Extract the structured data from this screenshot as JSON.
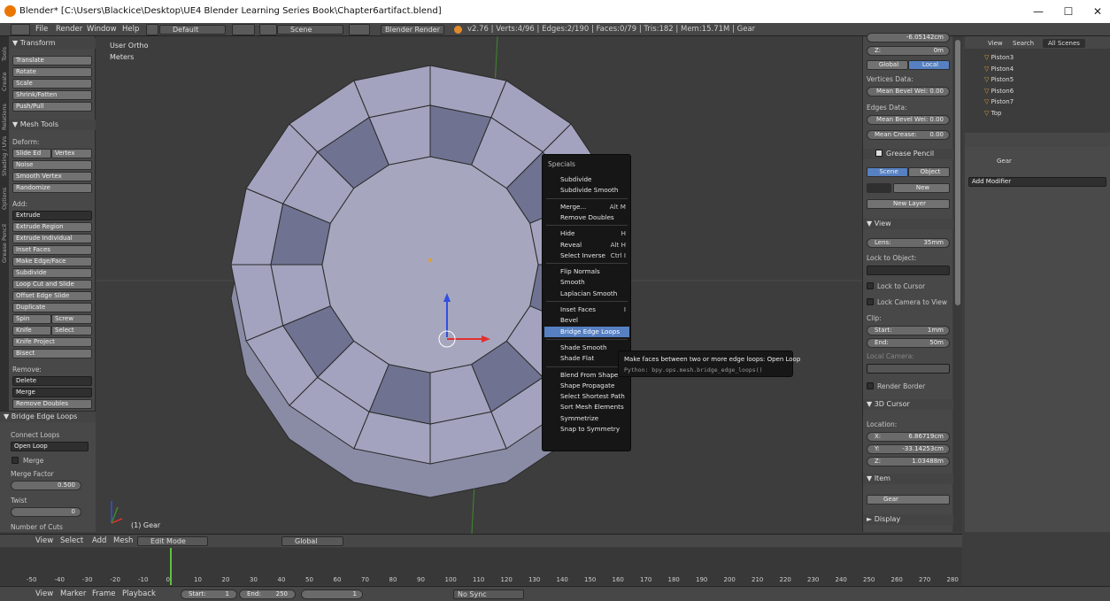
{
  "title": "Blender* [C:\\Users\\Blackice\\Desktop\\UE4 Blender Learning Series Book\\Chapter6artifact.blend]",
  "window_controls": {
    "min": "—",
    "max": "☐",
    "close": "✕"
  },
  "menu": {
    "file": "File",
    "render": "Render",
    "window": "Window",
    "help": "Help"
  },
  "layout": "Default",
  "scene": "Scene",
  "engine": "Blender Render",
  "stats": "v2.76 | Verts:4/96 | Edges:2/190 | Faces:0/79 | Tris:182 | Mem:15.71M | Gear",
  "tabs": [
    "Tools",
    "Create",
    "Relations",
    "Shading / UVs",
    "Options",
    "Grease Pencil"
  ],
  "transform": {
    "header": "▼ Transform",
    "buttons": [
      "Translate",
      "Rotate",
      "Scale",
      "Shrink/Fatten",
      "Push/Pull"
    ]
  },
  "mesh_tools": {
    "header": "▼ Mesh Tools",
    "deform": "Deform:",
    "slide_edge": "Slide Ed",
    "vertex": "Vertex",
    "noise": "Noise",
    "smooth_vertex": "Smooth Vertex",
    "randomize": "Randomize",
    "add": "Add:",
    "extrude": "Extrude",
    "extrude_region": "Extrude Region",
    "extrude_individual": "Extrude Individual",
    "inset_faces": "Inset Faces",
    "make_edge_face": "Make Edge/Face",
    "subdivide": "Subdivide",
    "loop_cut": "Loop Cut and Slide",
    "offset_edge": "Offset Edge Slide",
    "duplicate": "Duplicate",
    "spin": "Spin",
    "screw": "Screw",
    "knife": "Knife",
    "select": "Select",
    "knife_project": "Knife Project",
    "bisect": "Bisect",
    "remove": "Remove:",
    "delete": "Delete",
    "merge": "Merge",
    "remove_doubles": "Remove Doubles"
  },
  "operator": {
    "header": "▼ Bridge Edge Loops",
    "connect_loops": "Connect Loops",
    "connect_value": "Open Loop",
    "merge": "Merge",
    "merge_factor": "Merge Factor",
    "merge_factor_value": "0.500",
    "twist": "Twist",
    "twist_value": "0",
    "cuts": "Number of Cuts"
  },
  "viewport": {
    "view_name": "User Ortho",
    "units": "Meters",
    "object_label": "(1) Gear"
  },
  "specials": {
    "title": "Specials",
    "items": [
      {
        "label": "Subdivide",
        "shortcut": ""
      },
      {
        "label": "Subdivide Smooth",
        "shortcut": ""
      },
      {
        "label": "Merge...",
        "shortcut": "Alt M"
      },
      {
        "label": "Remove Doubles",
        "shortcut": ""
      },
      {
        "label": "Hide",
        "shortcut": "H"
      },
      {
        "label": "Reveal",
        "shortcut": "Alt H"
      },
      {
        "label": "Select Inverse",
        "shortcut": "Ctrl I"
      },
      {
        "label": "Flip Normals",
        "shortcut": ""
      },
      {
        "label": "Smooth",
        "shortcut": ""
      },
      {
        "label": "Laplacian Smooth",
        "shortcut": ""
      },
      {
        "label": "Inset Faces",
        "shortcut": "I"
      },
      {
        "label": "Bevel",
        "shortcut": ""
      },
      {
        "label": "Bridge Edge Loops",
        "shortcut": ""
      },
      {
        "label": "Shade Smooth",
        "shortcut": ""
      },
      {
        "label": "Shade Flat",
        "shortcut": ""
      },
      {
        "label": "Blend From Shape",
        "shortcut": ""
      },
      {
        "label": "Shape Propagate",
        "shortcut": ""
      },
      {
        "label": "Select Shortest Path",
        "shortcut": ""
      },
      {
        "label": "Sort Mesh Elements",
        "shortcut": ""
      },
      {
        "label": "Symmetrize",
        "shortcut": ""
      },
      {
        "label": "Snap to Symmetry",
        "shortcut": ""
      }
    ]
  },
  "tooltip": {
    "line1": "Make faces between two or more edge loops:  Open Loop",
    "line2": "Python: bpy.ops.mesh.bridge_edge_loops()"
  },
  "npanel": {
    "z_top": "Z:",
    "z_top_value": "0m",
    "y_top_value": "-6.05142cm",
    "global": "Global",
    "local": "Local",
    "vertices_data": "Vertices Data:",
    "mean_bevel_v": "Mean Bevel Wei: 0.00",
    "edges_data": "Edges Data:",
    "mean_bevel_e": "Mean Bevel Wei: 0.00",
    "mean_crease": "Mean Crease:",
    "mean_crease_value": "0.00",
    "grease": "Grease Pencil",
    "scene": "Scene",
    "object": "Object",
    "new": "New",
    "new_layer": "New Layer",
    "view": "▼ View",
    "lens": "Lens:",
    "lens_value": "35mm",
    "lock_obj": "Lock to Object:",
    "lock_cursor": "Lock to Cursor",
    "lock_cam": "Lock Camera to View",
    "clip": "Clip:",
    "start": "Start:",
    "start_value": "1mm",
    "end": "End:",
    "end_value": "50m",
    "local_camera": "Local Camera:",
    "render_border": "Render Border",
    "cursor": "▼ 3D Cursor",
    "location": "Location:",
    "cx": "X:",
    "cx_value": "6.86719cm",
    "cy": "Y:",
    "cy_value": "-33.14253cm",
    "cz": "Z:",
    "cz_value": "1.03488m",
    "item": "▼ Item",
    "item_name": "Gear",
    "display": "► Display"
  },
  "outliner": {
    "view": "View",
    "search": "Search",
    "all_scenes": "All Scenes",
    "items": [
      "Piston3",
      "Piston4",
      "Piston5",
      "Piston6",
      "Piston7",
      "Top"
    ]
  },
  "properties": {
    "object": "Gear",
    "add_modifier": "Add Modifier"
  },
  "viewheader": {
    "view": "View",
    "select": "Select",
    "add": "Add",
    "mesh": "Mesh",
    "mode": "Edit Mode",
    "orientation": "Global"
  },
  "timeline": {
    "ticks": [
      "-50",
      "-40",
      "-30",
      "-20",
      "-10",
      "0",
      "10",
      "20",
      "30",
      "40",
      "50",
      "60",
      "70",
      "80",
      "90",
      "100",
      "110",
      "120",
      "130",
      "140",
      "150",
      "160",
      "170",
      "180",
      "190",
      "200",
      "210",
      "220",
      "230",
      "240",
      "250",
      "260",
      "270",
      "280"
    ],
    "view": "View",
    "marker": "Marker",
    "frame": "Frame",
    "playback": "Playback",
    "start": "Start:",
    "start_value": "1",
    "end": "End:",
    "end_value": "250",
    "current": "1",
    "sync": "No Sync"
  },
  "colors": {
    "accent": "#5680c2",
    "header": "#474747",
    "panel": "#484848",
    "viewport": "#3d3d3d",
    "mesh": "#a3a3bf"
  }
}
